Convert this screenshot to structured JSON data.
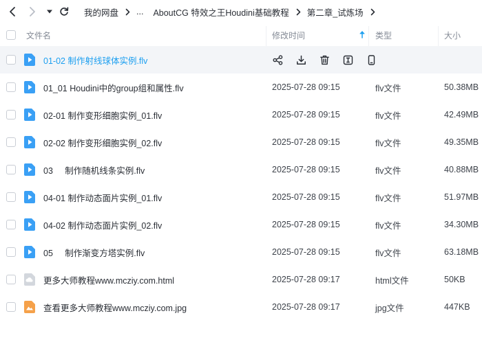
{
  "nav": {
    "back_icon": "chevron-left-icon",
    "forward_icon": "chevron-right-icon",
    "history_icon": "caret-down-icon",
    "refresh_icon": "refresh-icon"
  },
  "breadcrumb": {
    "root": "我的网盘",
    "ellipsis": "...",
    "level2": "AboutCG 特效之王Houdini基础教程",
    "level3": "第二章_试炼场"
  },
  "columns": {
    "name": "文件名",
    "modified": "修改时间",
    "type": "类型",
    "size": "大小",
    "sort_icon": "arrow-up-icon"
  },
  "colors": {
    "accent": "#1c9ff0",
    "video_icon": "#3aa0f5",
    "html_icon": "#d3d7dd",
    "image_icon": "#f5a14a",
    "selected_row": "#f3f5f8"
  },
  "row_actions": [
    "share-icon",
    "download-icon",
    "delete-icon",
    "rename-icon",
    "mobile-icon"
  ],
  "files": [
    {
      "name": "01-02 制作射线球体实例.flv",
      "date": "",
      "type": "",
      "size": "",
      "icon": "video-file-icon",
      "selected": true
    },
    {
      "name": "01_01 Houdini中的group组和属性.flv",
      "date": "2025-07-28 09:15",
      "type": "flv文件",
      "size": "50.38MB",
      "icon": "video-file-icon"
    },
    {
      "name": "02-01 制作变形细胞实例_01.flv",
      "date": "2025-07-28 09:15",
      "type": "flv文件",
      "size": "42.49MB",
      "icon": "video-file-icon"
    },
    {
      "name": "02-02 制作变形细胞实例_02.flv",
      "date": "2025-07-28 09:15",
      "type": "flv文件",
      "size": "49.35MB",
      "icon": "video-file-icon"
    },
    {
      "name": "03     制作随机线条实例.flv",
      "date": "2025-07-28 09:15",
      "type": "flv文件",
      "size": "40.88MB",
      "icon": "video-file-icon"
    },
    {
      "name": "04-01 制作动态面片实例_01.flv",
      "date": "2025-07-28 09:15",
      "type": "flv文件",
      "size": "51.97MB",
      "icon": "video-file-icon"
    },
    {
      "name": "04-02 制作动态面片实例_02.flv",
      "date": "2025-07-28 09:15",
      "type": "flv文件",
      "size": "34.30MB",
      "icon": "video-file-icon"
    },
    {
      "name": "05     制作渐变方塔实例.flv",
      "date": "2025-07-28 09:15",
      "type": "flv文件",
      "size": "63.18MB",
      "icon": "video-file-icon"
    },
    {
      "name": "更多大师教程www.mcziy.com.html",
      "date": "2025-07-28 09:17",
      "type": "html文件",
      "size": "50KB",
      "icon": "html-file-icon"
    },
    {
      "name": "查看更多大师教程www.mcziy.com.jpg",
      "date": "2025-07-28 09:17",
      "type": "jpg文件",
      "size": "447KB",
      "icon": "image-file-icon"
    }
  ]
}
